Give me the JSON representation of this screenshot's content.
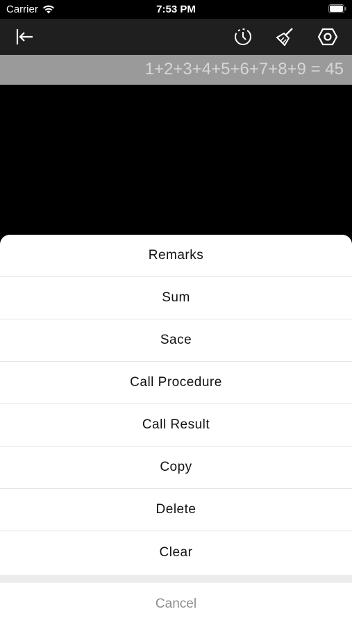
{
  "status_bar": {
    "carrier": "Carrier",
    "time": "7:53 PM"
  },
  "toolbar": {
    "icons": [
      "collapse-left-icon",
      "history-clock-icon",
      "brush-icon",
      "settings-hexagon-icon"
    ]
  },
  "display": {
    "expression": "1+2+3+4+5+6+7+8+9 = 45"
  },
  "action_sheet": {
    "items": [
      "Remarks",
      "Sum",
      "Sace",
      "Call Procedure",
      "Call Result",
      "Copy",
      "Delete",
      "Clear"
    ],
    "cancel_label": "Cancel"
  },
  "colors": {
    "toolbar_bg": "#1f1f1f",
    "display_bg": "#9a9a9a",
    "sheet_bg": "#ffffff",
    "cancel_text": "#8e8e8e"
  }
}
